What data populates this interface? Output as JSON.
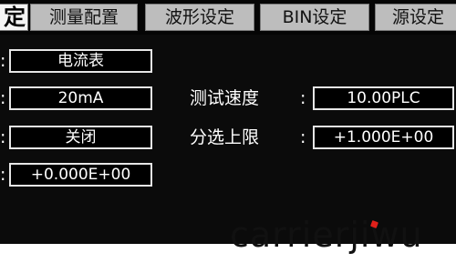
{
  "tabs": [
    {
      "label": "定",
      "active": true
    },
    {
      "label": "测量配置",
      "active": false
    },
    {
      "label": "波形设定",
      "active": false
    },
    {
      "label": "BIN设定",
      "active": false
    },
    {
      "label": "源设定",
      "active": false
    }
  ],
  "colon": ":",
  "params": {
    "meter": {
      "value": "电流表"
    },
    "range": {
      "value": "20mA"
    },
    "off": {
      "value": "关闭"
    },
    "offset": {
      "value": "+0.000E+00"
    },
    "speed": {
      "label": "测试速度",
      "value": "10.00PLC"
    },
    "upper_limit": {
      "label": "分选上限",
      "value": "+1.000E+00"
    }
  },
  "watermark": {
    "text": "carrierjiwu",
    "accent_color": "#e0201a"
  }
}
